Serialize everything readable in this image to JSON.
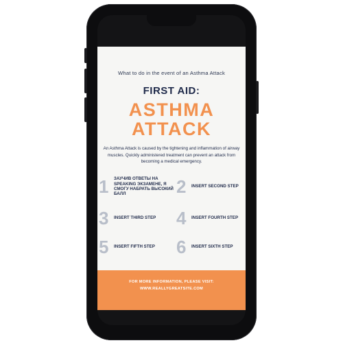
{
  "infographic": {
    "subtitle": "What to do in the event of an Asthma Attack",
    "heading": "FIRST AID:",
    "title_line1": "ASTHMA",
    "title_line2": "ATTACK",
    "description": "An Asthma Attack is caused by the tightening and inflammation of airway muscles. Quickly administered treatment can prevent an attack from becoming a medical emergency.",
    "steps": [
      {
        "number": "1",
        "label": "Заучив ответы на speaking экзамене, я смогу набрать высокий балл"
      },
      {
        "number": "2",
        "label": "INSERT SECOND STEP"
      },
      {
        "number": "3",
        "label": "INSERT THIRD STEP"
      },
      {
        "number": "4",
        "label": "INSERT FOURTH STEP"
      },
      {
        "number": "5",
        "label": "INSERT FIFTH STEP"
      },
      {
        "number": "6",
        "label": "INSERT SIXTH STEP"
      }
    ],
    "footer_line1": "FOR MORE INFORMATION, PLEASE VISIT:",
    "footer_line2": "WWW.REALLYGREATSITE.COM"
  },
  "colors": {
    "accent": "#f2914e",
    "navy": "#1f2a4a",
    "step_number": "#b8bec9",
    "background": "#f6f6f4",
    "phone_frame": "#0d0d0f"
  }
}
